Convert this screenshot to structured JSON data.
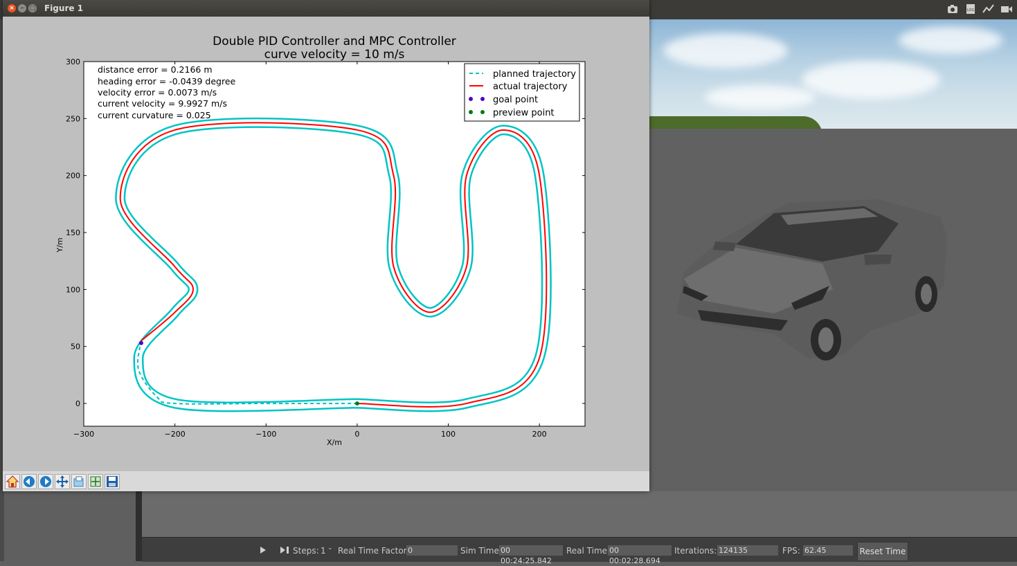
{
  "figure_window": {
    "title": "Figure 1",
    "toolbar": [
      {
        "name": "home-icon"
      },
      {
        "name": "back-arrow-icon"
      },
      {
        "name": "forward-arrow-icon"
      },
      {
        "name": "pan-icon"
      },
      {
        "name": "zoom-icon"
      },
      {
        "name": "configure-subplots-icon"
      },
      {
        "name": "save-icon"
      }
    ]
  },
  "plot": {
    "title_line1": "Double PID Controller and MPC Controller",
    "title_line2": "curve velocity = 10 m/s",
    "xlabel": "X/m",
    "ylabel": "Y/m",
    "info": [
      "distance error = 0.2166 m",
      "heading error = -0.0439 degree",
      "velocity error = 0.0073 m/s",
      "current velocity = 9.9927 m/s",
      "current curvature = 0.025"
    ],
    "legend": [
      {
        "label": "planned trajectory",
        "color": "#00bfbf",
        "style": "dashed"
      },
      {
        "label": "actual trajectory",
        "color": "#ff0000",
        "style": "solid"
      },
      {
        "label": "goal point",
        "color": "#4b00c8",
        "style": "dots"
      },
      {
        "label": "preview point",
        "color": "#007a1a",
        "style": "dots"
      }
    ]
  },
  "chart_data": {
    "type": "line",
    "title": "Double PID Controller and MPC Controller\ncurve velocity = 10 m/s",
    "xlabel": "X/m",
    "ylabel": "Y/m",
    "xlim": [
      -300,
      250
    ],
    "ylim": [
      -20,
      300
    ],
    "xticks": [
      -300,
      -200,
      -100,
      0,
      100,
      200
    ],
    "yticks": [
      0,
      50,
      100,
      150,
      200,
      250,
      300
    ],
    "grid": false,
    "legend_position": "top-right",
    "track_centerline": [
      [
        0,
        0
      ],
      [
        120,
        0
      ],
      [
        200,
        40
      ],
      [
        200,
        200
      ],
      [
        160,
        240
      ],
      [
        120,
        200
      ],
      [
        120,
        120
      ],
      [
        80,
        80
      ],
      [
        40,
        120
      ],
      [
        40,
        200
      ],
      [
        0,
        240
      ],
      [
        -200,
        240
      ],
      [
        -260,
        180
      ],
      [
        -200,
        120
      ],
      [
        -180,
        100
      ],
      [
        -200,
        80
      ],
      [
        -240,
        40
      ],
      [
        -200,
        0
      ],
      [
        0,
        0
      ]
    ],
    "series": [
      {
        "name": "planned trajectory",
        "style": "dashed",
        "color": "#00bfbf",
        "x": [
          -237,
          -240,
          -220,
          -200,
          -100,
          0
        ],
        "y": [
          55,
          30,
          6,
          0,
          0,
          0
        ]
      },
      {
        "name": "actual trajectory",
        "style": "solid",
        "color": "#ff0000",
        "x": [
          0,
          120,
          200,
          200,
          160,
          120,
          120,
          80,
          40,
          40,
          0,
          -200,
          -260,
          -200,
          -180,
          -200,
          -237
        ],
        "y": [
          0,
          0,
          40,
          200,
          240,
          200,
          120,
          80,
          120,
          200,
          240,
          240,
          180,
          120,
          100,
          80,
          55
        ]
      }
    ],
    "points": [
      {
        "name": "goal point",
        "x": -237,
        "y": 53,
        "color": "#4b00c8"
      },
      {
        "name": "preview point",
        "x": 0,
        "y": 0,
        "color": "#007a1a"
      }
    ]
  },
  "gazebo": {
    "toolbar_icons": [
      "camera-icon",
      "log-icon",
      "plot-icon",
      "video-icon"
    ],
    "status": {
      "steps_label": "Steps:",
      "steps_value": "1",
      "rtf_label": "Real Time Factor:",
      "rtf_value": "0",
      "sim_time_label": "Sim Time:",
      "sim_time_value": "00 00:24:25.842",
      "real_time_label": "Real Time:",
      "real_time_value": "00 00:02:28.694",
      "iterations_label": "Iterations:",
      "iterations_value": "124135",
      "fps_label": "FPS:",
      "fps_value": "62.45",
      "reset_label": "Reset Time"
    }
  }
}
